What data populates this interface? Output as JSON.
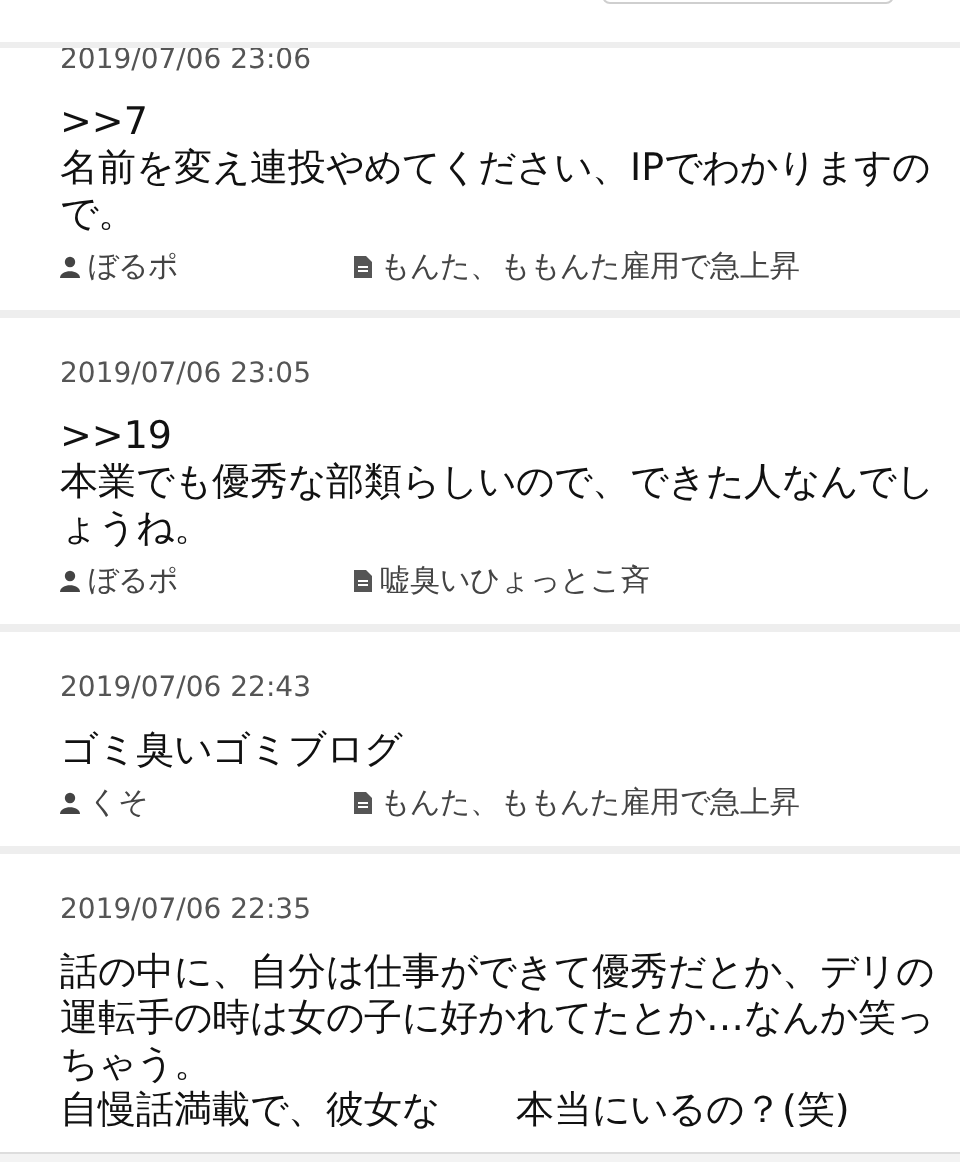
{
  "comments": [
    {
      "date": "2019/07/06 23:06",
      "reply_to": ">>7",
      "body": [
        "名前を変え連投やめてください、IPでわかりますので。"
      ],
      "author": "ぼるポ",
      "article": "もんた、ももんた雇用で急上昇"
    },
    {
      "date": "2019/07/06 23:05",
      "reply_to": ">>19",
      "body": [
        "本業でも優秀な部類らしいので、できた人なんでしょうね。"
      ],
      "author": "ぼるポ",
      "article": "嘘臭いひょっとこ斉"
    },
    {
      "date": "2019/07/06 22:43",
      "body": [
        "ゴミ臭いゴミブログ"
      ],
      "author": "くそ",
      "article": "もんた、ももんた雇用で急上昇"
    },
    {
      "date": "2019/07/06 22:35",
      "body": [
        "話の中に、自分は仕事ができて優秀だとか、デリの運転手の時は女の子に好かれてたとか…なんか笑っちゃう。"
      ],
      "body_last_line": [
        "自慢話満載で、彼女な",
        "本当にいるの？(笑)"
      ]
    }
  ]
}
